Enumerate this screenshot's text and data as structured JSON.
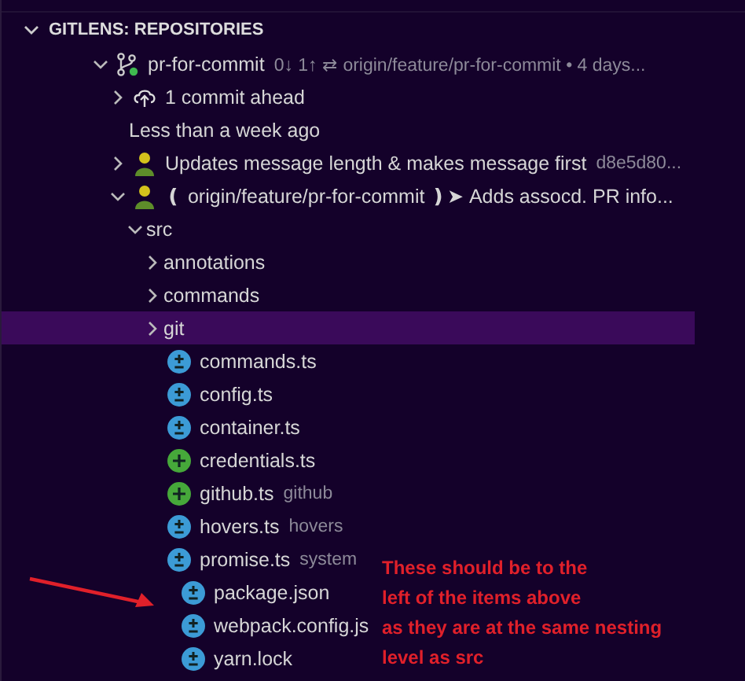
{
  "panel": {
    "title": "GITLENS: REPOSITORIES",
    "expanded": true
  },
  "tree": [
    {
      "label": "pr-for-commit",
      "description": "0↓ 1↑ ⇄ origin/feature/pr-for-commit • 4 days...",
      "kind": "branch",
      "expanded": true,
      "selected": false,
      "children": [
        {
          "label": "1 commit ahead",
          "kind": "cloud-upload",
          "expanded": false,
          "selected": false
        },
        {
          "label": "Less than a week ago",
          "kind": "group",
          "selected": false
        },
        {
          "label": "Updates message length & makes message first",
          "description": "d8e5d80...",
          "kind": "commit",
          "expanded": false,
          "selected": false
        },
        {
          "label": "❪ origin/feature/pr-for-commit ❫➤  Adds assocd. PR info...",
          "kind": "commit",
          "expanded": true,
          "selected": false,
          "children": [
            {
              "label": "src",
              "kind": "folder",
              "expanded": true,
              "selected": false,
              "children": [
                {
                  "label": "annotations",
                  "kind": "folder",
                  "expanded": false,
                  "selected": false
                },
                {
                  "label": "commands",
                  "kind": "folder",
                  "expanded": false,
                  "selected": false
                },
                {
                  "label": "git",
                  "kind": "folder",
                  "expanded": false,
                  "selected": true
                },
                {
                  "label": "commands.ts",
                  "kind": "modified",
                  "selected": false
                },
                {
                  "label": "config.ts",
                  "kind": "modified",
                  "selected": false
                },
                {
                  "label": "container.ts",
                  "kind": "modified",
                  "selected": false
                },
                {
                  "label": "credentials.ts",
                  "kind": "added",
                  "selected": false
                },
                {
                  "label": "github.ts",
                  "description": "github",
                  "kind": "added",
                  "selected": false
                },
                {
                  "label": "hovers.ts",
                  "description": "hovers",
                  "kind": "modified",
                  "selected": false
                },
                {
                  "label": "promise.ts",
                  "description": "system",
                  "kind": "modified",
                  "selected": false
                }
              ]
            },
            {
              "label": "package.json",
              "kind": "modified",
              "selected": false,
              "misaligned": true
            },
            {
              "label": "webpack.config.js",
              "kind": "modified",
              "selected": false,
              "misaligned": true
            },
            {
              "label": "yarn.lock",
              "kind": "modified",
              "selected": false,
              "misaligned": true
            }
          ]
        }
      ]
    }
  ],
  "annotation": {
    "lines": [
      "These should be to the",
      "left of the items above",
      "as they are at the same nesting",
      "level as src"
    ]
  }
}
